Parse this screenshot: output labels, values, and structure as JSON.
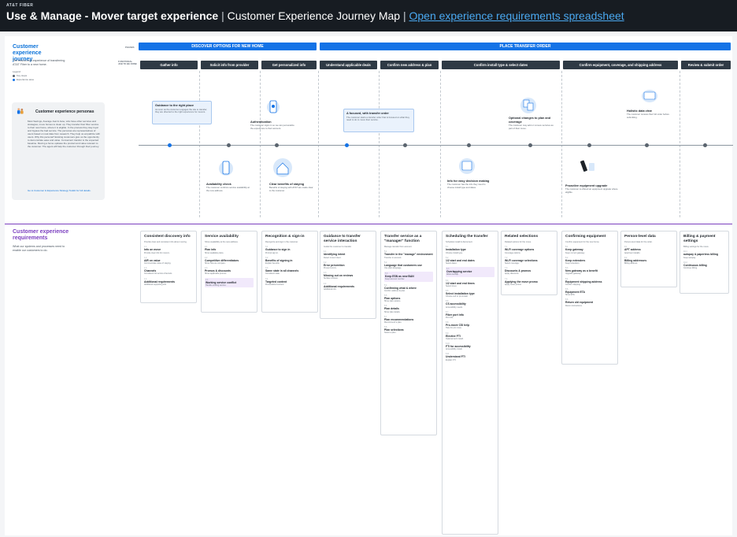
{
  "header": {
    "brand": "AT&T FIBER",
    "title_bold": "Use & Manage - Mover target experience",
    "title_sep": " | ",
    "title_rest": "Customer Experience Journey Map",
    "title_sep2": " | ",
    "link": "Open experience requirements spreadsheet"
  },
  "journey": {
    "title": "Customer experience journey",
    "desc": "The end-to-end experience of transferring AT&T Fiber to a new home.",
    "legend_label": "Legend",
    "legend_items": [
      "Key steps",
      "Experience area"
    ],
    "phase_label": "PHASES",
    "stage_label": "FUNCTIONAL JOB TO BE DONE"
  },
  "phases": [
    "DISCOVER OPTIONS FOR NEW HOME",
    "PLACE TRANSFER ORDER"
  ],
  "stages": [
    "Gather info",
    "Solicit info from provider",
    "Get personalized info",
    "Understand applicable deals",
    "Confirm new address & plan",
    "Confirm install type & select dates",
    "Confirm equipment, coverage, and shipping address",
    "Review & submit order"
  ],
  "persona": {
    "title": "Customer experience personas",
    "text": "Most Savings, Average Joel & Jane, who have other services and strategies, move homes to clean up. They transfer their fiber service to their new home, where it is eligible. In the process they stay loyal and bypass the bad service. The personas are representatives of users based on real data from research. They help us empathize with users. Why this persona? Existing customers give us the opportunity to demonstrate ease and value. Convenient transfer is the expected baseline. Moving a home updates the product and value relevant to the customer. The agent will help the customer through their journey.",
    "link_text": "Go to Customer & Experience Strategy Toolkit for full details."
  },
  "moments": [
    {
      "title": "Guidance to the right place",
      "text": "As soon as the customer engages the site to transfer, they are directed to the right experience for movers."
    },
    {
      "title": "Availability check",
      "text": "The customer confirms service availability at the new address."
    },
    {
      "title": "Authentication",
      "text": "The customer signs in so we can personalize the experience to their account."
    },
    {
      "title": "Clear benefits of staying",
      "text": "Benefits of staying with AT&T are made clear to the customer."
    },
    {
      "title": "A focused, with transfer order",
      "text": "The customer starts a transfer order that is focused on what they need to do to move their service."
    },
    {
      "title": "Optional changes to plan and coverage",
      "text": "The customer may add or remove services as part of their move."
    },
    {
      "title": "Info for easy decision making",
      "text": "The customer has the info they need to choose install type and dates."
    },
    {
      "title": "Proactive equipment upgrade",
      "text": "The customer is offered an equipment upgrade where eligible."
    },
    {
      "title": "Holistic data view",
      "text": "The customer reviews their full order before submitting."
    }
  ],
  "requirements": {
    "title": "Customer experience requirements",
    "desc": "What our systems and processes need to enable our customers to do."
  },
  "req_columns": [
    {
      "head": "Consistent discovery info",
      "desc": "Provide clear and consistent info about moving.",
      "items": [
        {
          "no": "1.1",
          "name": "Info on move",
          "text": "Provide clear info for movers."
        },
        {
          "no": "1.2",
          "name": "AIR on value",
          "text": "Communicate value of staying."
        },
        {
          "no": "1.3",
          "name": "Channels",
          "text": "Consistent info across channels."
        },
        {
          "no": "1.4",
          "name": "Additional requirements",
          "text": "Additional supporting info."
        }
      ]
    },
    {
      "head": "Service availability",
      "desc": "Show availability at the new address.",
      "items": [
        {
          "no": "2.1",
          "name": "Plan info",
          "text": "Show available plans."
        },
        {
          "no": "2.2",
          "name": "Competitive differentiators",
          "text": "Show how we compare."
        },
        {
          "no": "2.3",
          "name": "Promos & discounts",
          "text": "Show applicable promos."
        },
        {
          "no": "2.4",
          "name": "Working service conflict",
          "text": "Handle existing service.",
          "hl": true
        }
      ]
    },
    {
      "head": "Recognition & sign-in",
      "desc": "Recognize and sign in the customer.",
      "items": [
        {
          "no": "3.1",
          "name": "Guidance to sign in",
          "text": "Prompt sign in."
        },
        {
          "no": "3.2",
          "name": "Benefits of signing in",
          "text": "Explain benefits."
        },
        {
          "no": "3.3",
          "name": "Same state in all channels",
          "text": "Consistent state."
        },
        {
          "no": "3.4",
          "name": "Targeted content",
          "text": "Personalized content."
        }
      ]
    },
    {
      "head": "Guidance to transfer service interaction",
      "desc": "Guide the customer to transfer.",
      "items": [
        {
          "no": "4.1",
          "name": "Identifying intent",
          "text": "Detect mover intent."
        },
        {
          "no": "4.2",
          "name": "Error prevention",
          "text": "Prevent errors."
        },
        {
          "no": "4.3",
          "name": "Missing out on reviews",
          "text": "Surface reviews."
        },
        {
          "no": "4.4",
          "name": "Additional requirements",
          "text": "Additional info."
        }
      ]
    },
    {
      "head": "Transfer service as a \"manager\" function",
      "desc": "Manage transfer from account.",
      "items": [
        {
          "no": "5.1",
          "name": "Transfer in the \"manage\" environment",
          "text": "Transfer in account."
        },
        {
          "no": "5.2",
          "name": "Language that customers use",
          "text": "Use plain language."
        },
        {
          "no": "5.3",
          "name": "Keep ESN as new BAN",
          "text": "Keep account number.",
          "hl": true
        },
        {
          "no": "5.4",
          "name": "Confirming what & where",
          "text": "Confirm address & plan."
        },
        {
          "no": "5.5",
          "name": "Plan options",
          "text": "Show plan options."
        },
        {
          "no": "5.6",
          "name": "Plan details",
          "text": "Show plan details."
        },
        {
          "no": "5.7",
          "name": "Plan recommendations",
          "text": "Recommend a plan."
        },
        {
          "no": "5.8",
          "name": "Plan selections",
          "text": "Select a plan."
        }
      ]
    },
    {
      "head": "Scheduling the transfer",
      "desc": "Schedule install & disconnect.",
      "items": [
        {
          "no": "6.1",
          "name": "Installation type",
          "text": "Choose install type."
        },
        {
          "no": "6.2",
          "name": "1/2 start and end dates",
          "text": "Select dates."
        },
        {
          "no": "6.3",
          "name": "Overlapping service",
          "text": "Allow overlap.",
          "hl": true
        },
        {
          "no": "6.4",
          "name": "1/2 start and end times",
          "text": "Select times."
        },
        {
          "no": "6.5",
          "name": "Select installation type",
          "text": "Choose self or pro install."
        },
        {
          "no": "6.6",
          "name": "CS accessibility",
          "text": "Accessibility needs."
        },
        {
          "no": "6.7",
          "name": "Fiber port info",
          "text": "Port info."
        },
        {
          "no": "6.8",
          "name": "Pro-move CSI help",
          "text": "Help for pro move."
        },
        {
          "no": "6.9",
          "name": "Elective FTI",
          "text": "Optional tech install."
        },
        {
          "no": "6.10",
          "name": "FTI for accessibility",
          "text": "Accessibility install."
        },
        {
          "no": "6.11",
          "name": "Understand FTI",
          "text": "Explain FTI."
        }
      ]
    },
    {
      "head": "Related selections",
      "desc": "Related options for the move.",
      "items": [
        {
          "no": "7.1",
          "name": "Wi-Fi coverage options",
          "text": "Coverage options."
        },
        {
          "no": "7.2",
          "name": "Wi-Fi coverage selections",
          "text": "Select coverage."
        },
        {
          "no": "7.3",
          "name": "Discounts & promos",
          "text": "Apply discounts."
        },
        {
          "no": "7.4",
          "name": "Applying the move promo",
          "text": "Apply move promo."
        }
      ]
    },
    {
      "head": "Confirming equipment",
      "desc": "Confirm equipment for the new home.",
      "items": [
        {
          "no": "8.1",
          "name": "Keep gateway",
          "text": "Keep current gateway."
        },
        {
          "no": "8.2",
          "name": "Keep extenders",
          "text": "Keep extenders."
        },
        {
          "no": "8.3",
          "name": "New gateway as a benefit",
          "text": "Upgrade gateway."
        },
        {
          "no": "8.4",
          "name": "Equipment shipping address",
          "text": "Confirm shipping."
        },
        {
          "no": "8.5",
          "name": "Equipment ETA",
          "text": "Show ETA."
        },
        {
          "no": "8.6",
          "name": "Return old equipment",
          "text": "Return instructions."
        }
      ]
    },
    {
      "head": "Person-level data",
      "desc": "Person-level data for the order.",
      "items": [
        {
          "no": "9.1",
          "name": "APT address",
          "text": "Apartment details."
        },
        {
          "no": "9.2",
          "name": "Billing addresses",
          "text": "Billing address."
        }
      ]
    },
    {
      "head": "Billing & payment settings",
      "desc": "Billing settings for the move.",
      "items": [
        {
          "no": "10.1",
          "name": "autopay & paperless billing",
          "text": "Keep autopay."
        },
        {
          "no": "10.2",
          "name": "Continuous billing",
          "text": "Continue billing."
        }
      ]
    }
  ],
  "colors": {
    "accent": "#1473e6",
    "dark": "#171c22",
    "requirements": "#7b3fbf"
  }
}
